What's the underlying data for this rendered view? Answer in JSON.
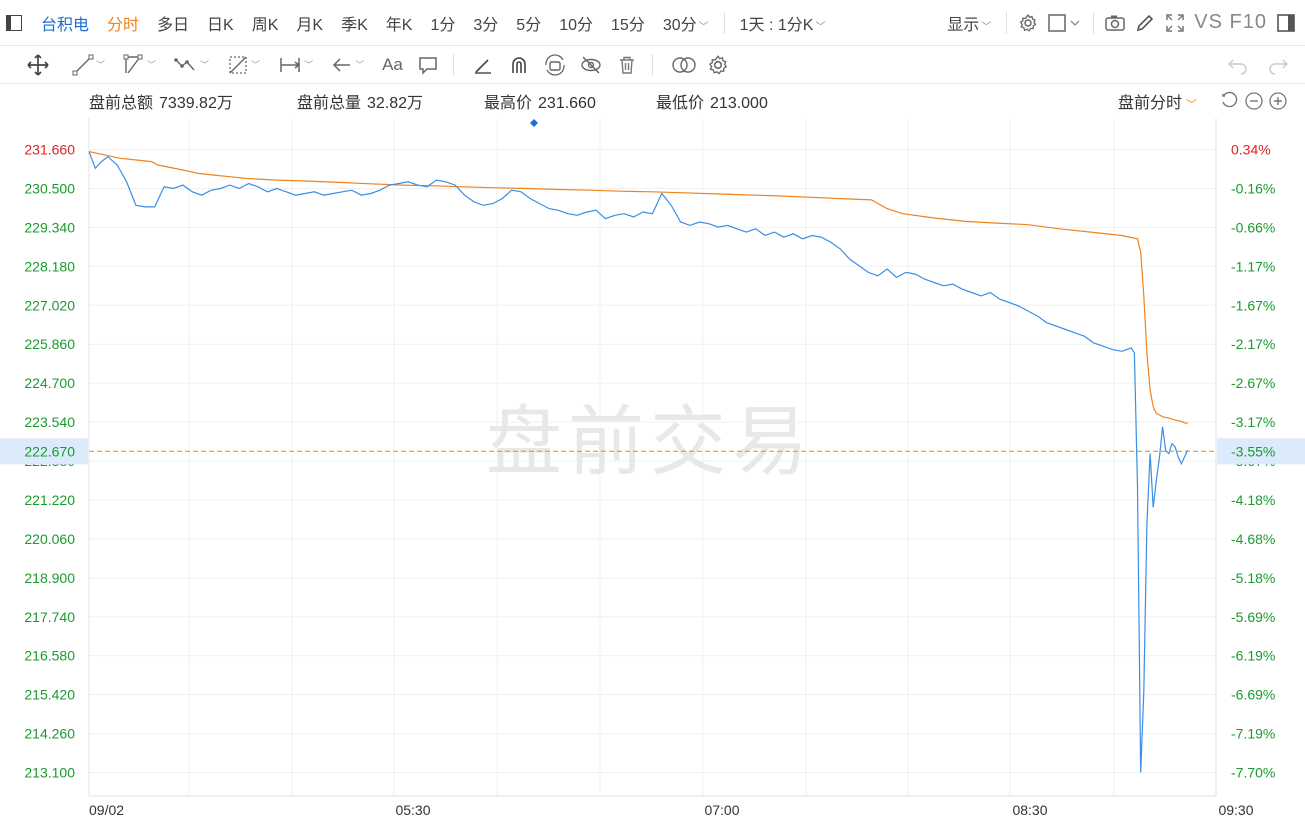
{
  "toolbar": {
    "symbol": "台积电",
    "timeframes": [
      "分时",
      "多日",
      "日K",
      "周K",
      "月K",
      "季K",
      "年K",
      "1分",
      "3分",
      "5分",
      "10分",
      "15分",
      "30分"
    ],
    "range_select": "1天 : 1分K",
    "display_label": "显示",
    "vs_f10_label": "VS F10"
  },
  "info": {
    "amount_label": "盘前总额",
    "amount_value": "7339.82万",
    "volume_label": "盘前总量",
    "volume_value": "32.82万",
    "high_label": "最高价",
    "high_value": "231.660",
    "low_label": "最低价",
    "low_value": "213.000",
    "mode_label": "盘前分时"
  },
  "colors": {
    "price_line": "#3a8ee6",
    "avg_line": "#f0831e",
    "up_text": "#e02020",
    "down_text": "#1a9b2e",
    "crosshair": "#f0831e",
    "watermark": "#e8e8e8"
  },
  "chart_data": {
    "type": "line",
    "watermark": "盘前交易",
    "current_price_label": "222.670",
    "current_pct_label": "-3.55%",
    "current_price": 222.67,
    "ylim": [
      212.4,
      232.6
    ],
    "x_ticks": [
      "09/02",
      "05:30",
      "07:00",
      "08:30",
      "09:30"
    ],
    "y_ticks": [
      "231.660",
      "230.500",
      "229.340",
      "228.180",
      "227.020",
      "225.860",
      "224.700",
      "223.540",
      "222.380",
      "221.220",
      "220.060",
      "218.900",
      "217.740",
      "216.580",
      "215.420",
      "214.260",
      "213.100"
    ],
    "y_tick_values": [
      231.66,
      230.5,
      229.34,
      228.18,
      227.02,
      225.86,
      224.7,
      223.54,
      222.38,
      221.22,
      220.06,
      218.9,
      217.74,
      216.58,
      215.42,
      214.26,
      213.1
    ],
    "pct_ticks": [
      "0.34%",
      "-0.16%",
      "-0.66%",
      "-1.17%",
      "-1.67%",
      "-2.17%",
      "-2.67%",
      "-3.17%",
      "-3.67%",
      "-4.18%",
      "-4.68%",
      "-5.18%",
      "-5.69%",
      "-6.19%",
      "-6.69%",
      "-7.19%",
      "-7.70%"
    ],
    "series": [
      {
        "key": "price",
        "x": [
          0,
          2,
          4,
          6,
          9,
          12,
          15,
          18,
          21,
          24,
          27,
          30,
          33,
          36,
          39,
          42,
          45,
          48,
          51,
          54,
          57,
          60,
          63,
          66,
          69,
          72,
          75,
          78,
          81,
          84,
          87,
          90,
          93,
          96,
          99,
          102,
          105,
          108,
          111,
          114,
          117,
          120,
          123,
          126,
          129,
          132,
          135,
          138,
          141,
          144,
          147,
          150,
          153,
          156,
          159,
          162,
          165,
          168,
          171,
          174,
          177,
          180,
          183,
          186,
          189,
          192,
          195,
          198,
          201,
          204,
          207,
          210,
          213,
          216,
          219,
          222,
          225,
          228,
          231,
          234,
          237,
          240,
          243,
          246,
          249,
          252,
          255,
          258,
          261,
          264,
          267,
          270,
          273,
          276,
          279,
          282,
          285,
          288,
          291,
          294,
          297,
          300,
          303,
          306,
          309,
          312,
          315,
          318,
          321,
          324,
          327,
          330,
          333,
          334,
          335,
          336,
          337,
          338,
          339,
          340,
          341,
          342,
          343,
          344,
          345,
          346,
          347,
          348,
          349,
          350,
          351
        ],
        "y": [
          231.6,
          231.1,
          231.3,
          231.45,
          231.2,
          230.7,
          230.0,
          229.95,
          229.95,
          230.55,
          230.5,
          230.6,
          230.4,
          230.3,
          230.45,
          230.5,
          230.6,
          230.5,
          230.65,
          230.55,
          230.4,
          230.5,
          230.4,
          230.3,
          230.35,
          230.4,
          230.3,
          230.35,
          230.4,
          230.45,
          230.3,
          230.35,
          230.45,
          230.6,
          230.65,
          230.7,
          230.6,
          230.55,
          230.75,
          230.7,
          230.6,
          230.3,
          230.1,
          230.0,
          230.05,
          230.2,
          230.45,
          230.4,
          230.2,
          230.05,
          229.9,
          229.85,
          229.75,
          229.7,
          229.8,
          229.85,
          229.6,
          229.7,
          229.75,
          229.65,
          229.8,
          229.75,
          230.35,
          230.0,
          229.5,
          229.4,
          229.5,
          229.45,
          229.35,
          229.4,
          229.3,
          229.2,
          229.3,
          229.1,
          229.2,
          229.05,
          229.15,
          229.0,
          229.1,
          229.05,
          228.9,
          228.7,
          228.4,
          228.2,
          228.0,
          227.9,
          228.1,
          227.85,
          228.0,
          227.95,
          227.8,
          227.7,
          227.6,
          227.65,
          227.5,
          227.4,
          227.3,
          227.4,
          227.2,
          227.1,
          227.0,
          226.85,
          226.7,
          226.5,
          226.4,
          226.3,
          226.2,
          226.1,
          225.9,
          225.8,
          225.7,
          225.65,
          225.75,
          225.6,
          221.6,
          213.1,
          215.5,
          220.5,
          222.6,
          221.0,
          221.8,
          222.5,
          223.4,
          222.7,
          222.6,
          222.9,
          222.8,
          222.5,
          222.3,
          222.5,
          222.7
        ]
      },
      {
        "key": "avg",
        "x": [
          0,
          10,
          20,
          22,
          30,
          35,
          40,
          45,
          50,
          60,
          70,
          80,
          90,
          100,
          110,
          120,
          130,
          140,
          150,
          160,
          170,
          180,
          190,
          200,
          210,
          220,
          230,
          240,
          250,
          255,
          260,
          270,
          280,
          290,
          300,
          310,
          320,
          330,
          335,
          336,
          337,
          338,
          339,
          340,
          341,
          342,
          343,
          344,
          345,
          346,
          347,
          348,
          349,
          350,
          351
        ],
        "y": [
          231.6,
          231.4,
          231.3,
          231.2,
          231.05,
          230.95,
          230.9,
          230.85,
          230.8,
          230.75,
          230.72,
          230.68,
          230.64,
          230.6,
          230.58,
          230.55,
          230.52,
          230.5,
          230.47,
          230.45,
          230.42,
          230.4,
          230.37,
          230.34,
          230.31,
          230.28,
          230.24,
          230.2,
          230.16,
          229.9,
          229.75,
          229.62,
          229.52,
          229.47,
          229.42,
          229.3,
          229.2,
          229.1,
          229.0,
          228.6,
          227.3,
          225.6,
          224.5,
          224.0,
          223.8,
          223.75,
          223.7,
          223.68,
          223.66,
          223.63,
          223.6,
          223.58,
          223.56,
          223.52,
          223.5
        ]
      }
    ]
  }
}
